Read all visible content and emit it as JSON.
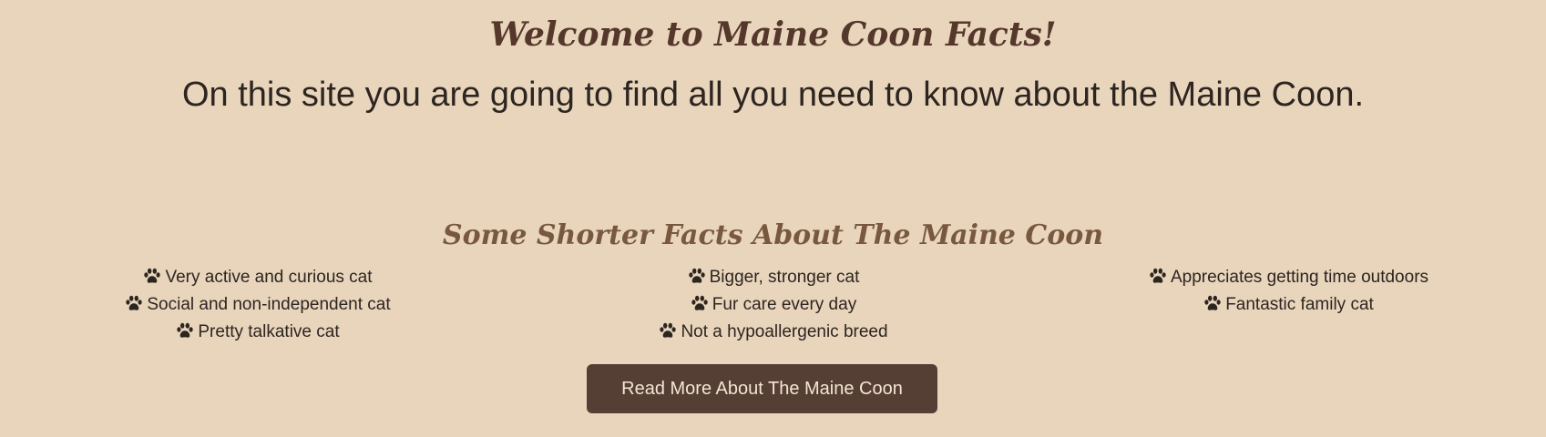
{
  "hero": {
    "title": "Welcome to Maine Coon Facts!",
    "subtitle": "On this site you are going to find all you need to know about the Maine Coon."
  },
  "facts": {
    "title": "Some Shorter Facts About The Maine Coon",
    "icon": "paw-icon",
    "columns": [
      {
        "items": [
          "Very active and curious cat",
          "Social and non-independent cat",
          "Pretty talkative cat"
        ]
      },
      {
        "items": [
          "Bigger, stronger cat",
          "Fur care every day",
          "Not a hypoallergenic breed"
        ]
      },
      {
        "items": [
          "Appreciates getting time outdoors",
          "Fantastic family cat"
        ]
      }
    ]
  },
  "cta": {
    "label": "Read More About The Maine Coon"
  },
  "colors": {
    "background": "#e8d5bc",
    "title": "#55382b",
    "section_title": "#785940",
    "text": "#2d2520",
    "button_bg": "#553e33",
    "button_text": "#f3e5d3"
  }
}
